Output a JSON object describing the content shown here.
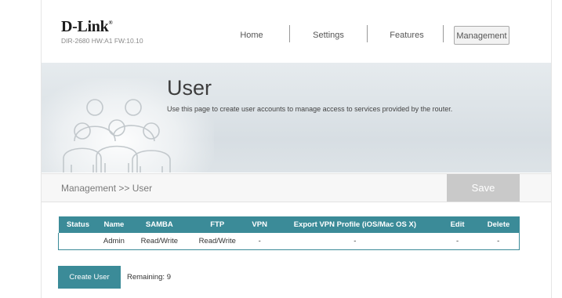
{
  "brand": {
    "logo": "D-Link",
    "mark": "®",
    "model": "DIR-2680 HW:A1 FW:10.10"
  },
  "nav": [
    {
      "label": "Home"
    },
    {
      "label": "Settings"
    },
    {
      "label": "Features"
    },
    {
      "label": "Management",
      "active": true
    }
  ],
  "page": {
    "title": "User",
    "description": "Use this page to create user accounts to manage access to services provided by the router."
  },
  "breadcrumb": "Management >> User",
  "save_label": "Save",
  "table": {
    "headers": [
      "Status",
      "Name",
      "SAMBA",
      "FTP",
      "VPN",
      "Export VPN Profile (iOS/Mac OS X)",
      "Edit",
      "Delete"
    ],
    "rows": [
      [
        "",
        "Admin",
        "Read/Write",
        "Read/Write",
        "-",
        "-",
        "-",
        "-"
      ]
    ]
  },
  "create_user_label": "Create User",
  "remaining_text": "Remaining: 9",
  "colors": {
    "accent": "#3b8b98",
    "save_disabled": "#c9c9c9"
  }
}
